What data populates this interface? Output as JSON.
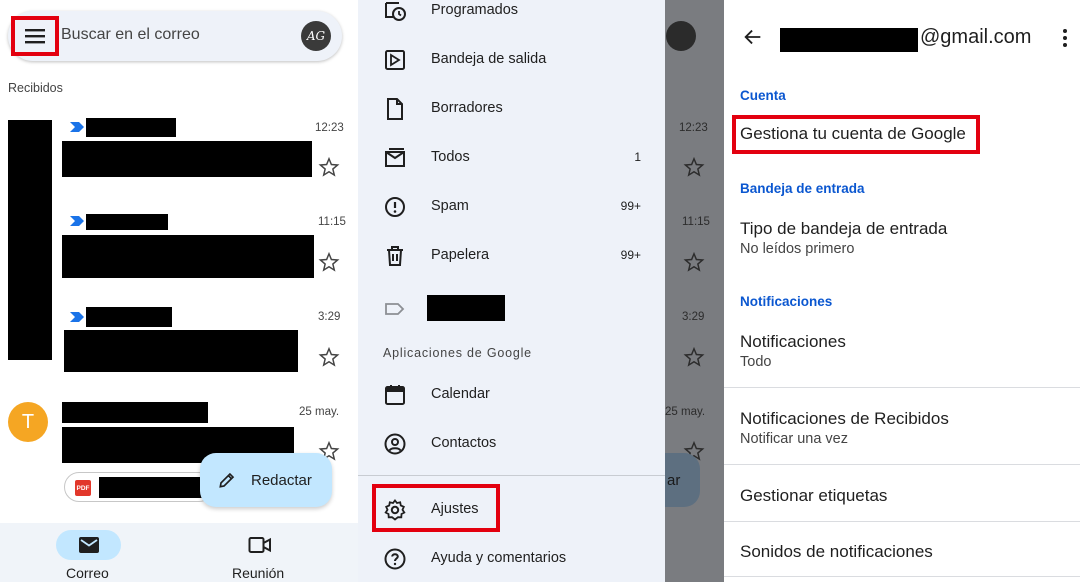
{
  "inbox": {
    "search_placeholder": "Buscar en el correo",
    "avatar_initials": "AG",
    "section_label": "Recibidos",
    "emails": [
      {
        "time": "12:23"
      },
      {
        "time": "11:15"
      },
      {
        "time": "3:29"
      },
      {
        "time": "25 may.",
        "avatar_letter": "T",
        "attachment_type": "PDF"
      }
    ],
    "fab_label": "Redactar",
    "nav": [
      {
        "label": "Correo"
      },
      {
        "label": "Reunión"
      }
    ],
    "colors": {
      "accent": "#c2e7ff",
      "highlight": "#e3000f",
      "avatar": "#f5a623"
    }
  },
  "drawer": {
    "items": [
      {
        "label": "Programados",
        "count": "",
        "icon": "scheduled-icon"
      },
      {
        "label": "Bandeja de salida",
        "count": "",
        "icon": "outbox-icon"
      },
      {
        "label": "Borradores",
        "count": "",
        "icon": "draft-icon"
      },
      {
        "label": "Todos",
        "count": "1",
        "icon": "all-mail-icon"
      },
      {
        "label": "Spam",
        "count": "99+",
        "icon": "spam-icon"
      },
      {
        "label": "Papelera",
        "count": "99+",
        "icon": "trash-icon"
      }
    ],
    "apps_heading": "Aplicaciones de Google",
    "apps": [
      {
        "label": "Calendar",
        "icon": "calendar-icon"
      },
      {
        "label": "Contactos",
        "icon": "contacts-icon"
      }
    ],
    "settings_label": "Ajustes",
    "help_label": "Ayuda y comentarios",
    "behind": {
      "times": [
        "12:23",
        "11:15",
        "3:29",
        "25 may."
      ],
      "fab_partial": "ar"
    }
  },
  "settings": {
    "email_suffix": "@gmail.com",
    "sections": [
      {
        "heading": "Cuenta"
      },
      {
        "heading": "Bandeja de entrada"
      },
      {
        "heading": "Notificaciones"
      }
    ],
    "manage_account": "Gestiona tu cuenta de Google",
    "inbox_type": {
      "title": "Tipo de bandeja de entrada",
      "value": "No leídos primero"
    },
    "notifications": {
      "title": "Notificaciones",
      "value": "Todo"
    },
    "inbox_notifications": {
      "title": "Notificaciones de Recibidos",
      "value": "Notificar una vez"
    },
    "manage_labels": "Gestionar etiquetas",
    "notification_sounds": "Sonidos de notificaciones"
  }
}
